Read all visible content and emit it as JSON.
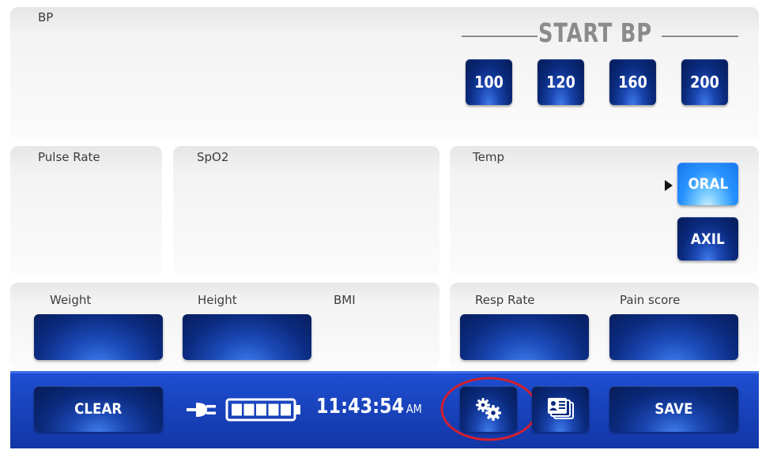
{
  "bp": {
    "label": "BP",
    "start_title": "START BP",
    "presets": [
      "100",
      "120",
      "160",
      "200"
    ]
  },
  "pulse": {
    "label": "Pulse Rate"
  },
  "spo2": {
    "label": "SpO2"
  },
  "temp": {
    "label": "Temp",
    "oral_label": "ORAL",
    "axil_label": "AXIL",
    "selected_mode": "ORAL"
  },
  "body_metrics": {
    "weight_label": "Weight",
    "height_label": "Height",
    "bmi_label": "BMI"
  },
  "resp": {
    "resp_label": "Resp Rate",
    "pain_label": "Pain score"
  },
  "toolbar": {
    "clear_label": "CLEAR",
    "save_label": "SAVE",
    "time": "11:43:54",
    "ampm": "AM",
    "battery_level": "full",
    "power_icon": "plug-icon",
    "settings_icon": "gears-icon",
    "records_icon": "patient-cards-icon"
  },
  "colors": {
    "toolbar_blue": "#1a45c0",
    "button_dark_blue": "#0a2a7d",
    "selected_light_blue": "#2791ff",
    "highlight_ring": "#d1202f",
    "panel_grey": "#efefef"
  }
}
